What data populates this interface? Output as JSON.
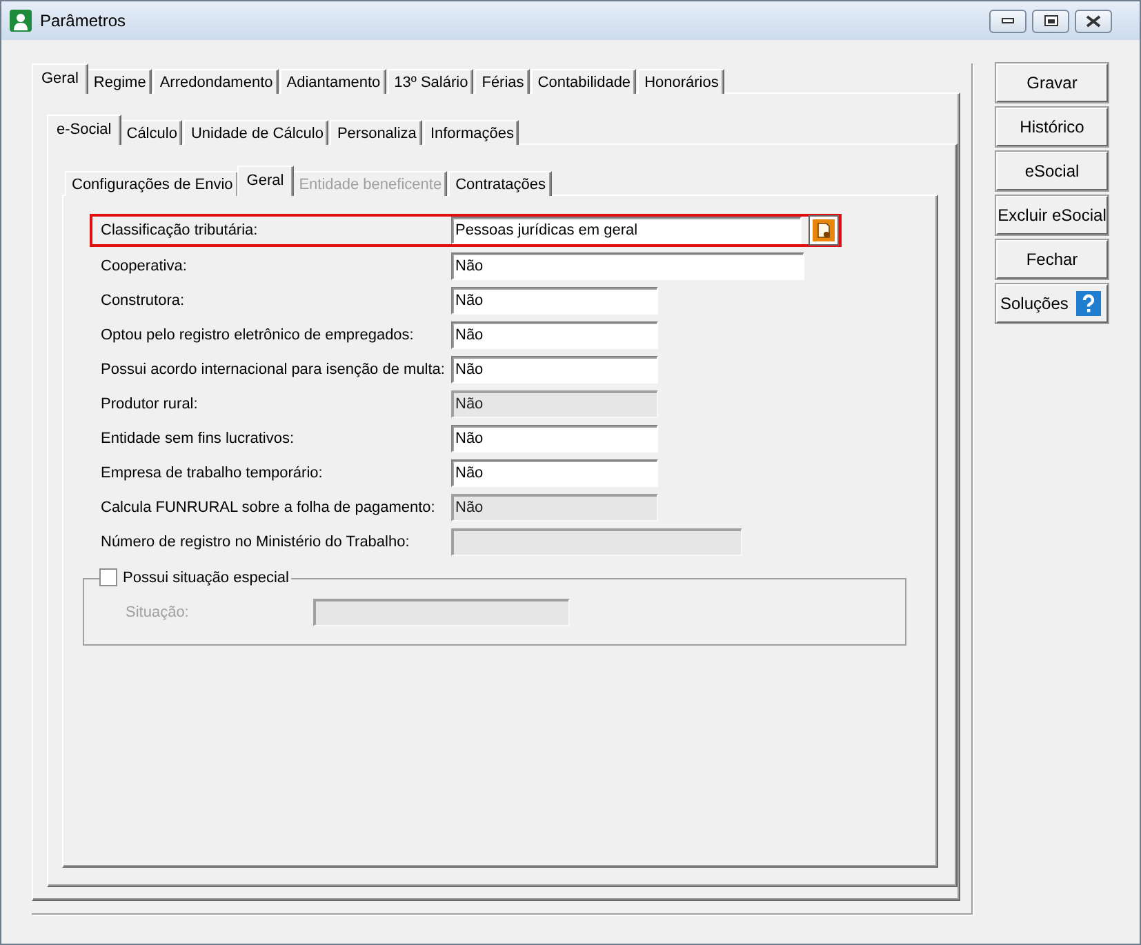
{
  "window": {
    "title": "Parâmetros"
  },
  "tabs": [
    {
      "label": "Geral",
      "selected": true
    },
    {
      "label": "Regime",
      "selected": false
    },
    {
      "label": "Arredondamento",
      "selected": false
    },
    {
      "label": "Adiantamento",
      "selected": false
    },
    {
      "label": "13º Salário",
      "selected": false
    },
    {
      "label": "Férias",
      "selected": false
    },
    {
      "label": "Contabilidade",
      "selected": false
    },
    {
      "label": "Honorários",
      "selected": false
    }
  ],
  "subtabs": [
    {
      "label": "e-Social",
      "selected": true
    },
    {
      "label": "Cálculo",
      "selected": false
    },
    {
      "label": "Unidade de Cálculo",
      "selected": false
    },
    {
      "label": "Personaliza",
      "selected": false
    },
    {
      "label": "Informações",
      "selected": false
    }
  ],
  "inner_tabs": [
    {
      "label": "Configurações de Envio",
      "selected": false,
      "disabled": false
    },
    {
      "label": "Geral",
      "selected": true,
      "disabled": false
    },
    {
      "label": "Entidade beneficente",
      "selected": false,
      "disabled": true
    },
    {
      "label": "Contratações",
      "selected": false,
      "disabled": false
    }
  ],
  "fields": [
    {
      "label": "Classificação tributária:",
      "value": "Pessoas jurídicas em geral",
      "kind": "lookup",
      "highlighted": true,
      "disabled": false
    },
    {
      "label": "Cooperativa:",
      "value": "Não",
      "kind": "wide",
      "highlighted": false,
      "disabled": false
    },
    {
      "label": "Construtora:",
      "value": "Não",
      "kind": "choice",
      "highlighted": false,
      "disabled": false
    },
    {
      "label": "Optou pelo registro eletrônico de empregados:",
      "value": "Não",
      "kind": "choice",
      "highlighted": false,
      "disabled": false
    },
    {
      "label": "Possui acordo internacional para isenção de multa:",
      "value": "Não",
      "kind": "choice",
      "highlighted": false,
      "disabled": false
    },
    {
      "label": "Produtor rural:",
      "value": "Não",
      "kind": "choice",
      "highlighted": false,
      "disabled": true
    },
    {
      "label": "Entidade sem fins lucrativos:",
      "value": "Não",
      "kind": "choice",
      "highlighted": false,
      "disabled": false
    },
    {
      "label": "Empresa de trabalho temporário:",
      "value": "Não",
      "kind": "choice",
      "highlighted": false,
      "disabled": false
    },
    {
      "label": "Calcula FUNRURAL sobre a folha de pagamento:",
      "value": "Não",
      "kind": "choice",
      "highlighted": false,
      "disabled": true
    },
    {
      "label": "Número de registro no Ministério do Trabalho:",
      "kind": "text",
      "highlighted": false,
      "disabled": true
    }
  ],
  "special": {
    "label": "Possui situação especial",
    "checked": false,
    "field_label": "Situação:",
    "disabled": true
  },
  "buttons": [
    {
      "label": "Gravar",
      "kind": "plain"
    },
    {
      "label": "Histórico",
      "kind": "plain"
    },
    {
      "label": "eSocial",
      "kind": "plain"
    },
    {
      "label": "Excluir eSocial",
      "kind": "plain"
    },
    {
      "label": "Fechar",
      "kind": "plain"
    },
    {
      "label": "Soluções",
      "kind": "help"
    }
  ]
}
